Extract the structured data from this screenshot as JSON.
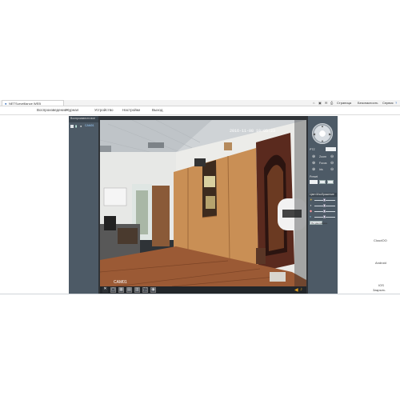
{
  "browser": {
    "tab_title": "NETSurveillance WEB"
  },
  "toolbar_right": {
    "page_menu": "Страница",
    "safety_menu": "Безопасность",
    "service_menu": "Сервис"
  },
  "nav": {
    "items": [
      {
        "label": "Воспроизведение"
      },
      {
        "label": "Журнал"
      },
      {
        "label": "Устройство"
      },
      {
        "label": "Настройки"
      },
      {
        "label": "Выход"
      }
    ]
  },
  "left_panel": {
    "header": "Воспроизвести все",
    "channel_label": "CAM01"
  },
  "video": {
    "timestamp": "2016-11-08 10:05:23",
    "channel_overlay": "CAM01"
  },
  "right_panel": {
    "ptz_label": "PTZ",
    "zoom_label": "Zoom",
    "focus_label": "Focus",
    "iris_label": "Iris",
    "preset_label": "Preset",
    "color_label": "Цвет/Изображение",
    "default_button": "По умолчанию"
  },
  "right_captions": {
    "c1": "CloudOO",
    "c2": "Android",
    "c3": "IOS",
    "c4": "Закрыть"
  },
  "colors": {
    "panel": "#4d5a66",
    "video_bg": "#2f3337"
  }
}
